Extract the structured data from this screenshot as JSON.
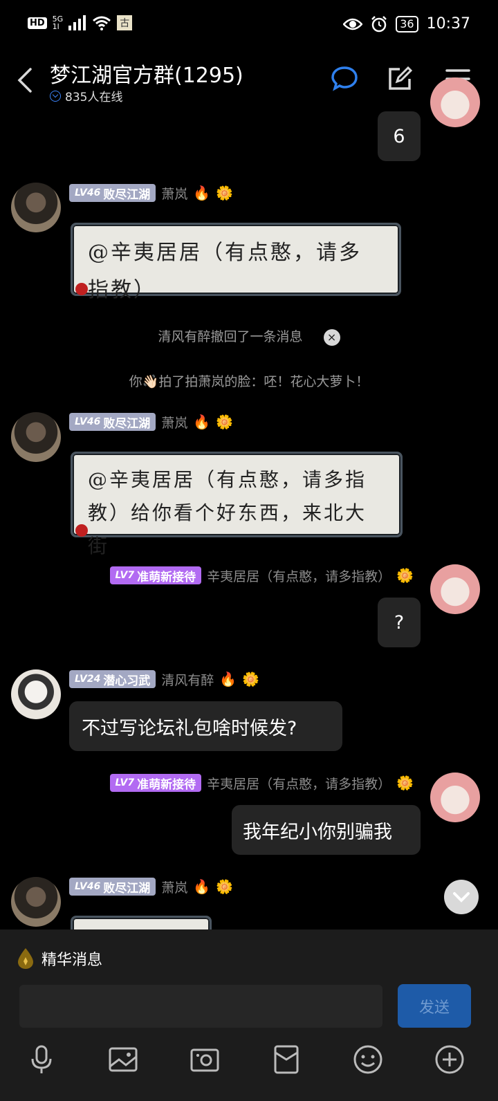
{
  "status_bar": {
    "hd": "HD",
    "network": "5G",
    "network_sub": "1l",
    "app_badge": "古",
    "battery": "36",
    "time": "10:37"
  },
  "header": {
    "title": "梦江湖官方群(1295)",
    "online": "835人在线"
  },
  "messages": {
    "m1": {
      "text": "6"
    },
    "m2": {
      "level": "LV46",
      "badge": "败尽江湖",
      "nick": "萧岚",
      "card_text": "@辛夷居居（有点憨，请多指教）"
    },
    "sys1": {
      "text": "清风有醉撤回了一条消息",
      "close": "×"
    },
    "sys2": {
      "text": "你👋🏻拍了拍萧岚的脸：呸！花心大萝卜！"
    },
    "m3": {
      "level": "LV46",
      "badge": "败尽江湖",
      "nick": "萧岚",
      "card_text": "@辛夷居居（有点憨，请多指教）给你看个好东西，来北大街"
    },
    "m4": {
      "level": "LV7",
      "badge": "准萌新接待",
      "nick": "辛夷居居（有点憨，请多指教）",
      "text": "?"
    },
    "m5": {
      "level": "LV24",
      "badge": "潜心习武",
      "nick": "清风有醉",
      "text": "不过写论坛礼包啥时候发?"
    },
    "m6": {
      "level": "LV7",
      "badge": "准萌新接待",
      "nick": "辛夷居居（有点憨，请多指教）",
      "text": "我年纪小你别骗我"
    },
    "m7": {
      "level": "LV46",
      "badge": "败尽江湖",
      "nick": "萧岚"
    }
  },
  "bottom": {
    "essence": "精华消息",
    "send": "发送"
  },
  "colors": {
    "accent": "#3b82f6",
    "badge_grey": "#a3a8c3",
    "badge_purple": "#b26bf2",
    "send_bg": "#1e5ba8"
  },
  "icons": [
    "back-icon",
    "chat-bubble-icon",
    "edit-icon",
    "menu-icon",
    "drop-icon",
    "mic-icon",
    "image-icon",
    "camera-icon",
    "red-packet-icon",
    "emoji-icon",
    "plus-icon",
    "chevron-down-icon"
  ]
}
